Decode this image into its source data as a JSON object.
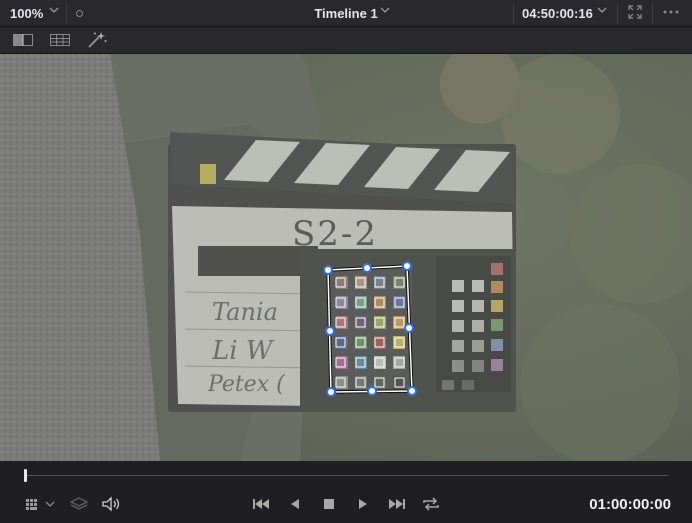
{
  "topbar": {
    "zoom_label": "100%",
    "timeline_title": "Timeline 1",
    "source_timecode": "04:50:00:16"
  },
  "clip": {
    "slate_scene_text": "S2-2",
    "slate_names": [
      "Tania",
      "Li W",
      "Petex ("
    ]
  },
  "transport": {
    "timecode": "01:00:00:00",
    "playhead_fraction": 0.0
  },
  "colors": {
    "accent": "#2f6fe8",
    "panel": "#28282d",
    "background": "#1f1f23"
  }
}
